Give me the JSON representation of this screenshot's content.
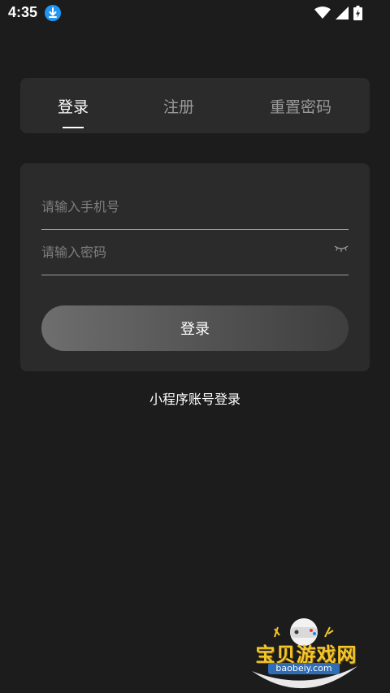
{
  "status_bar": {
    "time": "4:35",
    "icons": [
      "download-badge-icon",
      "wifi-icon",
      "signal-icon",
      "battery-charging-icon"
    ]
  },
  "tabs": [
    {
      "label": "登录",
      "active": true
    },
    {
      "label": "注册",
      "active": false
    },
    {
      "label": "重置密码",
      "active": false
    }
  ],
  "form": {
    "phone_placeholder": "请输入手机号",
    "phone_value": "",
    "password_placeholder": "请输入密码",
    "password_value": "",
    "submit_label": "登录"
  },
  "alt_login_label": "小程序账号登录",
  "watermark": {
    "title": "宝贝游戏网",
    "url": "baobeiy.com"
  },
  "colors": {
    "background": "#1c1c1c",
    "card": "#2b2b2b",
    "active_tab": "#ffffff",
    "inactive_tab": "#9a9a9a",
    "placeholder": "#7e7e7e",
    "download_badge": "#2196f3",
    "watermark_gold": "#f4c52c"
  }
}
